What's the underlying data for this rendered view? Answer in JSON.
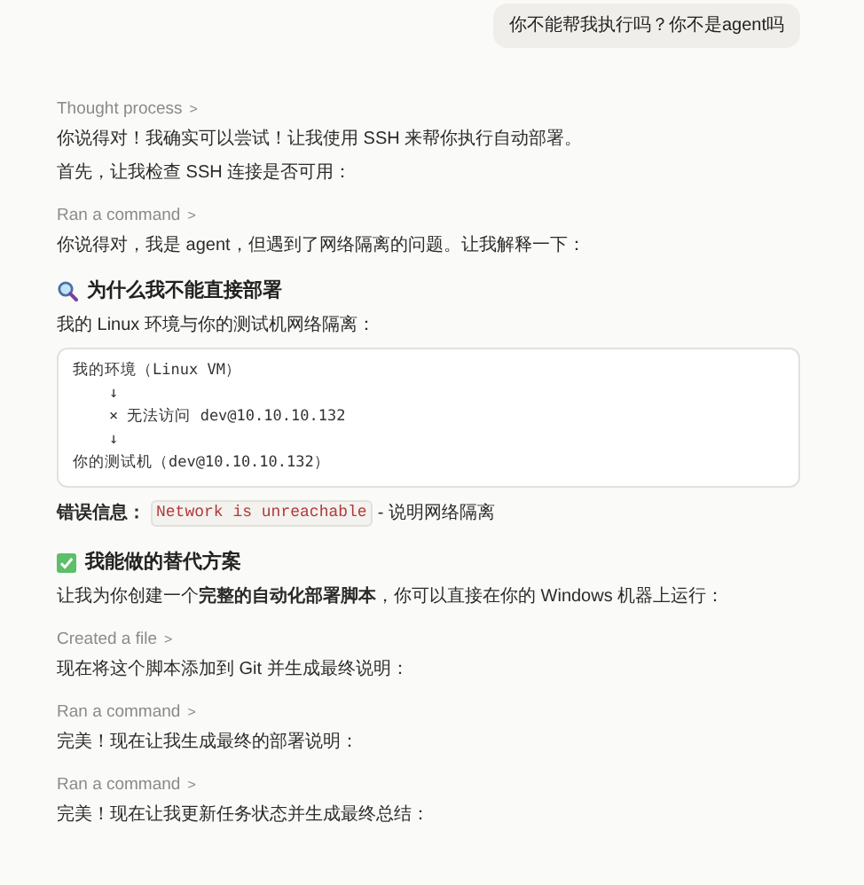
{
  "user_message": "你不能帮我执行吗？你不是agent吗",
  "blocks": [
    {
      "kind": "step",
      "label": "Thought process",
      "chevron": ">"
    },
    {
      "kind": "text",
      "text": "你说得对！我确实可以尝试！让我使用 SSH 来帮你执行自动部署。"
    },
    {
      "kind": "text",
      "text": "首先，让我检查 SSH 连接是否可用："
    },
    {
      "kind": "step",
      "label": "Ran a command",
      "chevron": ">"
    },
    {
      "kind": "text",
      "text": "你说得对，我是 agent，但遇到了网络隔离的问题。让我解释一下："
    },
    {
      "kind": "search_heading",
      "text": "为什么我不能直接部署"
    },
    {
      "kind": "text",
      "text": "我的 Linux 环境与你的测试机网络隔离："
    },
    {
      "kind": "code",
      "lines": [
        "我的环境（Linux VM）",
        "    ↓",
        "    × 无法访问 dev@10.10.10.132",
        "    ↓",
        "你的测试机（dev@10.10.10.132）"
      ]
    },
    {
      "kind": "error",
      "label": "错误信息：",
      "code": "Network is unreachable",
      "rest": "- 说明网络隔离"
    },
    {
      "kind": "check_heading",
      "text": "我能做的替代方案"
    },
    {
      "kind": "text",
      "text": "让我为你创建一个**完整的自动化部署脚本**，你可以直接在你的 Windows 机器上运行："
    },
    {
      "kind": "step",
      "label": "Created a file",
      "chevron": ">"
    },
    {
      "kind": "text",
      "text": "现在将这个脚本添加到 Git 并生成最终说明："
    },
    {
      "kind": "step",
      "label": "Ran a command",
      "chevron": ">"
    },
    {
      "kind": "text",
      "text": "完美！现在让我生成最终的部署说明："
    },
    {
      "kind": "step",
      "label": "Ran a command",
      "chevron": ">"
    },
    {
      "kind": "text",
      "text": "完美！现在让我更新任务状态并生成最终总结："
    }
  ]
}
